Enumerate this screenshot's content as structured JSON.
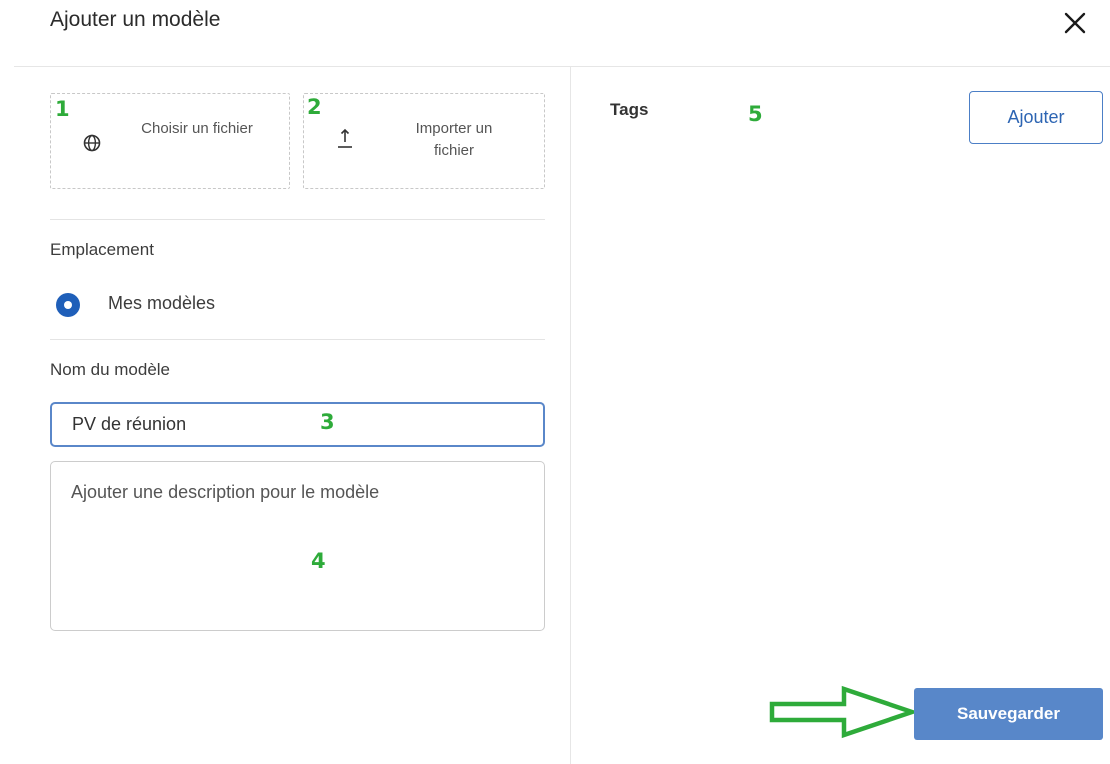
{
  "dialog": {
    "title": "Ajouter un modèle",
    "close_icon": "close-icon"
  },
  "upload_options": [
    {
      "badge": "1",
      "icon": "globe-icon",
      "label": "Choisir un fichier"
    },
    {
      "badge": "2",
      "icon": "upload-icon",
      "label": "Importer un fichier"
    }
  ],
  "location": {
    "label": "Emplacement",
    "option_label": "Mes modèles",
    "selected": true
  },
  "template_name": {
    "label": "Nom du modèle",
    "value": "PV de réunion",
    "badge": "3"
  },
  "description": {
    "placeholder": "Ajouter une description pour le modèle",
    "badge": "4"
  },
  "tags": {
    "label": "Tags",
    "badge": "5",
    "add_label": "Ajouter"
  },
  "actions": {
    "save_label": "Sauvegarder"
  },
  "colors": {
    "accent": "#1f5fb9",
    "save_button": "#5887c9",
    "annotation": "#2eab3a"
  }
}
